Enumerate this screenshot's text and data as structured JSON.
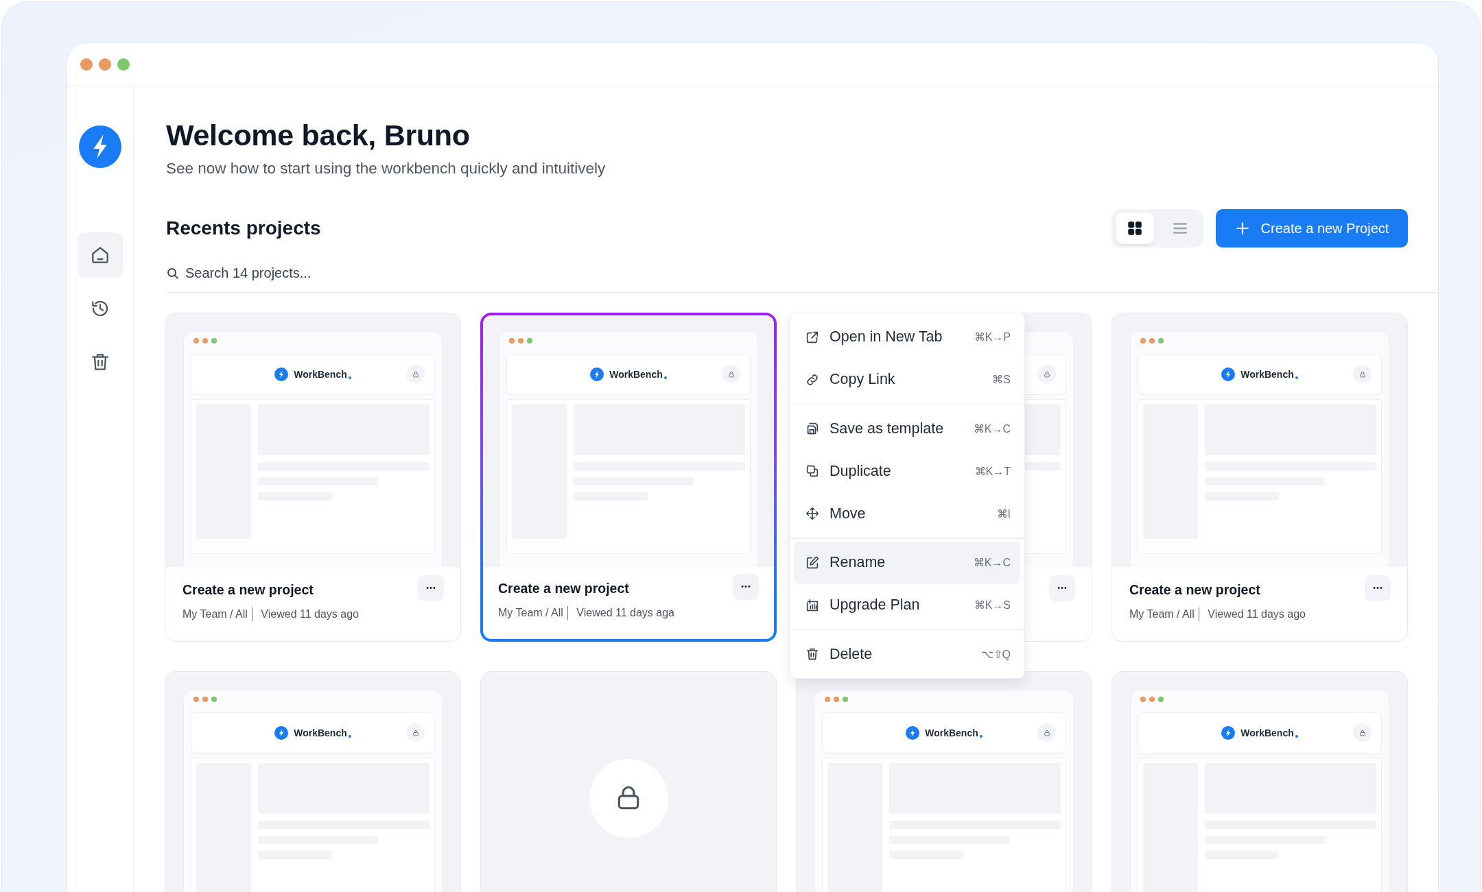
{
  "window": {
    "traffic_lights": [
      {
        "color": "#e89a5f"
      },
      {
        "color": "#e89a5f"
      },
      {
        "color": "#7cc86a"
      }
    ]
  },
  "sidebar": {
    "items": [
      {
        "kind": "home",
        "selected": true
      },
      {
        "kind": "history",
        "selected": false
      },
      {
        "kind": "trash",
        "selected": false
      }
    ]
  },
  "header": {
    "title": "Welcome back, Bruno",
    "subtitle": "See now how to start using the workbench quickly and intuitively"
  },
  "section": {
    "title": "Recents projects",
    "view_options": [
      {
        "kind": "grid",
        "selected": true
      },
      {
        "kind": "list",
        "selected": false
      }
    ],
    "create_button": "Create a new Project"
  },
  "search": {
    "placeholder": "Search 14 projects..."
  },
  "cards": [
    {
      "kind": "preview",
      "selected": false,
      "preview_brand": "WorkBench",
      "title": "Create a new project",
      "team": "My Team / All",
      "viewed": "Viewed 11 days ago"
    },
    {
      "kind": "preview",
      "selected": true,
      "preview_brand": "WorkBench",
      "title": "Create a new project",
      "team": "My Team / All",
      "viewed": "Viewed 11 days aga"
    },
    {
      "kind": "preview",
      "selected": false
    },
    {
      "kind": "preview",
      "selected": false,
      "preview_brand": "WorkBench",
      "title": "Create a new project",
      "team": "My Team / All",
      "viewed": "Viewed 11 days ago"
    },
    {
      "kind": "preview",
      "selected": false,
      "preview_brand": "WorkBench"
    },
    {
      "kind": "locked",
      "selected": false
    },
    {
      "kind": "preview",
      "selected": false,
      "preview_brand": "WorkBench"
    },
    {
      "kind": "preview",
      "selected": false,
      "preview_brand": "WorkBench"
    }
  ],
  "context_menu": {
    "groups": [
      {
        "items": [
          {
            "kind": "external",
            "label": "Open in New Tab",
            "shortcut": "⌘K→P",
            "highlighted": false
          },
          {
            "kind": "link",
            "label": "Copy Link",
            "shortcut": "⌘S",
            "highlighted": false
          }
        ]
      },
      {
        "items": [
          {
            "kind": "save",
            "label": "Save as template",
            "shortcut": "⌘K→C",
            "highlighted": false
          },
          {
            "kind": "duplicate",
            "label": "Duplicate",
            "shortcut": "⌘K→T",
            "highlighted": false
          },
          {
            "kind": "move",
            "label": "Move",
            "shortcut": "⌘I",
            "highlighted": false
          }
        ]
      },
      {
        "items": [
          {
            "kind": "edit",
            "label": "Rename",
            "shortcut": "⌘K→C",
            "highlighted": true
          },
          {
            "kind": "chart",
            "label": "Upgrade Plan",
            "shortcut": "⌘K→S",
            "highlighted": false
          }
        ]
      },
      {
        "items": [
          {
            "kind": "trash",
            "label": "Delete",
            "shortcut": "⌥⇧Q",
            "highlighted": false
          }
        ]
      }
    ]
  }
}
